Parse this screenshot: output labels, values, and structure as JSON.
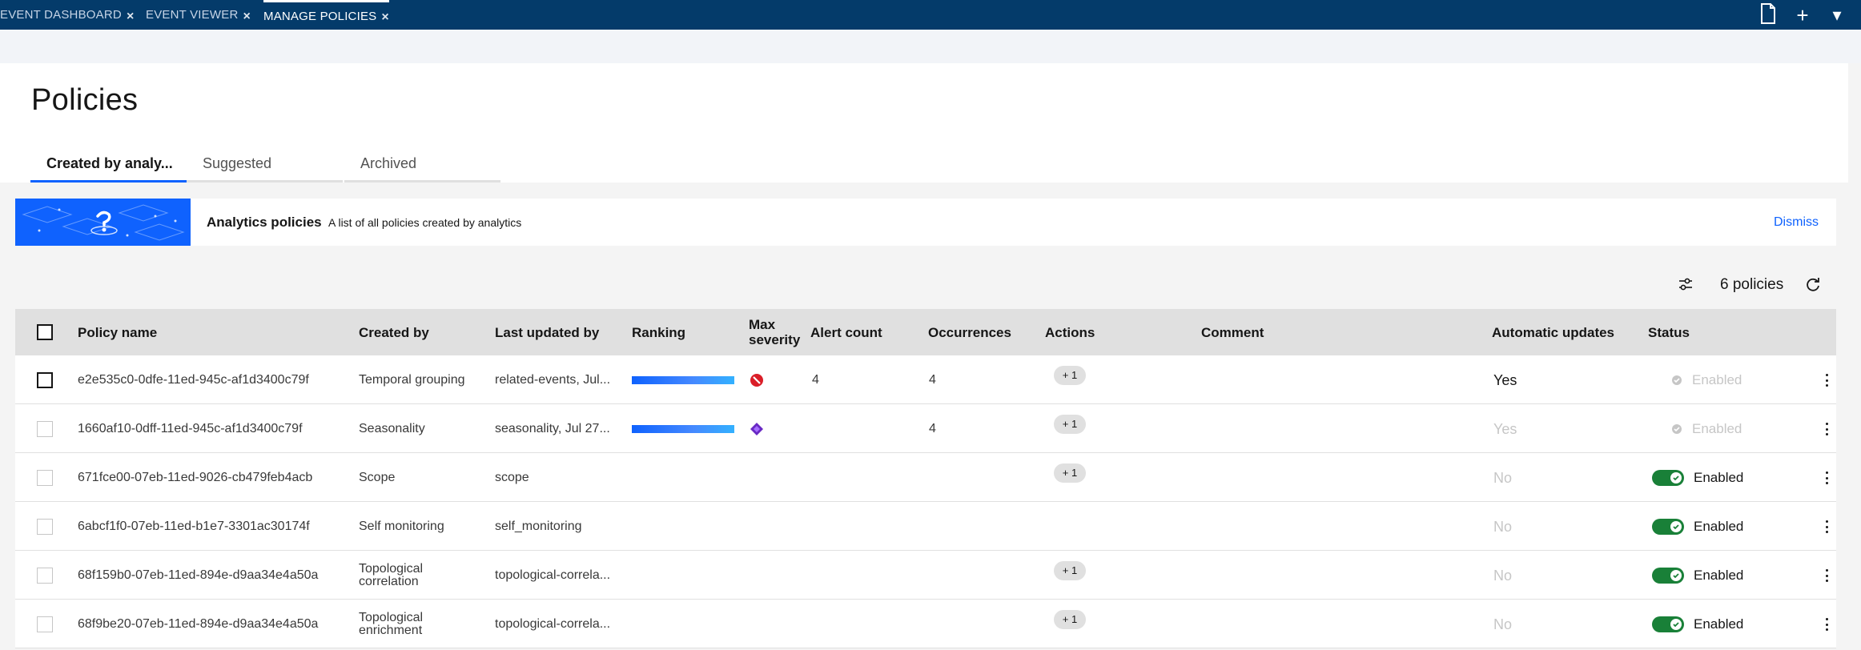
{
  "top_tabs": [
    {
      "label": "EVENT DASHBOARD",
      "close": "×"
    },
    {
      "label": "EVENT VIEWER",
      "close": "×"
    },
    {
      "label": "MANAGE POLICIES",
      "close": "×"
    }
  ],
  "top_icons": {
    "document": "document-icon",
    "add": "+",
    "menu": "▾"
  },
  "page": {
    "title": "Policies",
    "tabs": [
      "Created by analy...",
      "Suggested",
      "Archived"
    ]
  },
  "banner": {
    "title": "Analytics policies",
    "description": "A list of all policies created by analytics",
    "dismiss": "Dismiss"
  },
  "toolbar": {
    "count_label": "6 policies"
  },
  "table": {
    "columns": {
      "policy_name": "Policy name",
      "created_by": "Created by",
      "last_updated_by": "Last updated by",
      "ranking": "Ranking",
      "max_severity": "Max severity",
      "alert_count": "Alert count",
      "occurrences": "Occurrences",
      "actions": "Actions",
      "comment": "Comment",
      "automatic_updates": "Automatic updates",
      "status": "Status"
    },
    "rows": [
      {
        "policy_name": "e2e535c0-0dfe-11ed-945c-af1d3400c79f",
        "created_by": "Temporal grouping",
        "last_updated_by": "related-events, Jul...",
        "ranking": 1.0,
        "severity": "critical",
        "alert_count": "4",
        "occurrences": "4",
        "action_chip": "+ 1",
        "auto_updates": "Yes",
        "status": "Enabled"
      },
      {
        "policy_name": "1660af10-0dff-11ed-945c-af1d3400c79f",
        "created_by": "Seasonality",
        "last_updated_by": "seasonality, Jul 27...",
        "ranking": 1.0,
        "severity": "diamond",
        "alert_count": "",
        "occurrences": "4",
        "action_chip": "+ 1",
        "auto_updates": "Yes",
        "status": "Enabled"
      },
      {
        "policy_name": "671fce00-07eb-11ed-9026-cb479feb4acb",
        "created_by": "Scope",
        "last_updated_by": "scope",
        "action_chip": "+ 1",
        "auto_updates": "No",
        "status": "Enabled"
      },
      {
        "policy_name": "6abcf1f0-07eb-11ed-b1e7-3301ac30174f",
        "created_by": "Self monitoring",
        "last_updated_by": "self_monitoring",
        "action_chip": "",
        "auto_updates": "No",
        "status": "Enabled"
      },
      {
        "policy_name": "68f159b0-07eb-11ed-894e-d9aa34e4a50a",
        "created_by": "Topological correlation",
        "last_updated_by": "topological-correla...",
        "action_chip": "+ 1",
        "auto_updates": "No",
        "status": "Enabled"
      },
      {
        "policy_name": "68f9be20-07eb-11ed-894e-d9aa34e4a50a",
        "created_by": "Topological enrichment",
        "last_updated_by": "topological-correla...",
        "action_chip": "+ 1",
        "auto_updates": "No",
        "status": "Enabled"
      }
    ]
  },
  "colors": {
    "topbar": "#043b6a",
    "accent": "#0f62fe",
    "toggle_on": "#198038",
    "critical": "#da1e28",
    "diamond": "#6929c4"
  }
}
